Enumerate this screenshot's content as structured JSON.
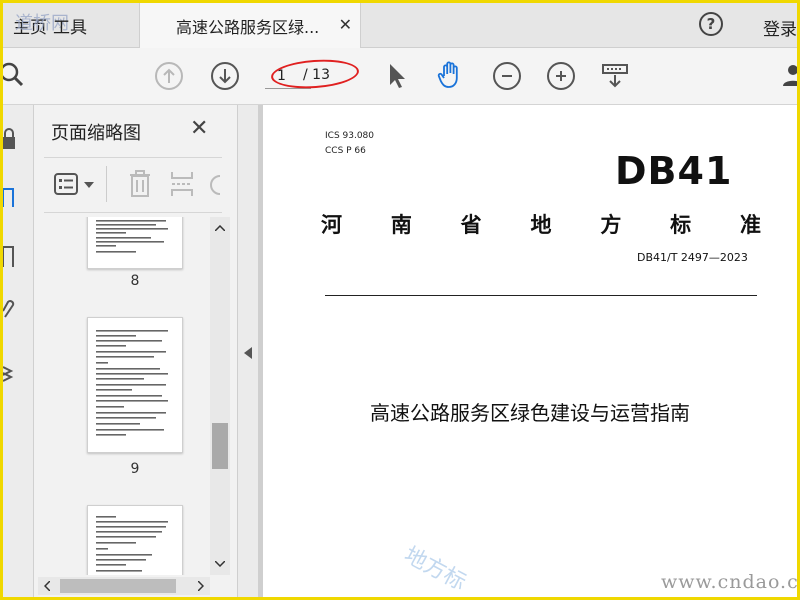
{
  "app": {
    "tabs": [
      {
        "label": "主页"
      },
      {
        "label": "工具"
      },
      {
        "label": "高速公路服务区绿..."
      }
    ],
    "close_glyph": "✕",
    "help_glyph": "?",
    "login_label": "登录",
    "watermark_logo": "道桥网"
  },
  "toolbar": {
    "page_current": "1",
    "page_total": "/ 13"
  },
  "panel": {
    "title": "页面缩略图",
    "close_glyph": "✕",
    "thumbnails": [
      {
        "label": "8"
      },
      {
        "label": "9"
      }
    ]
  },
  "document": {
    "ics_line": "ICS  93.080",
    "ccs_line": "CCS  P 66",
    "db_mark": "DB41",
    "standard_chars": [
      "河",
      "南",
      "省",
      "地",
      "方",
      "标",
      "准"
    ],
    "standard_code": "DB41/T 2497—2023",
    "title": "高速公路服务区绿色建设与运营指南",
    "watermark_text": "地方标",
    "site_watermark": "www.cndao.com"
  },
  "colors": {
    "frame": "#f0d800",
    "annotation": "#e02020",
    "hand_tool": "#1a73d9"
  }
}
